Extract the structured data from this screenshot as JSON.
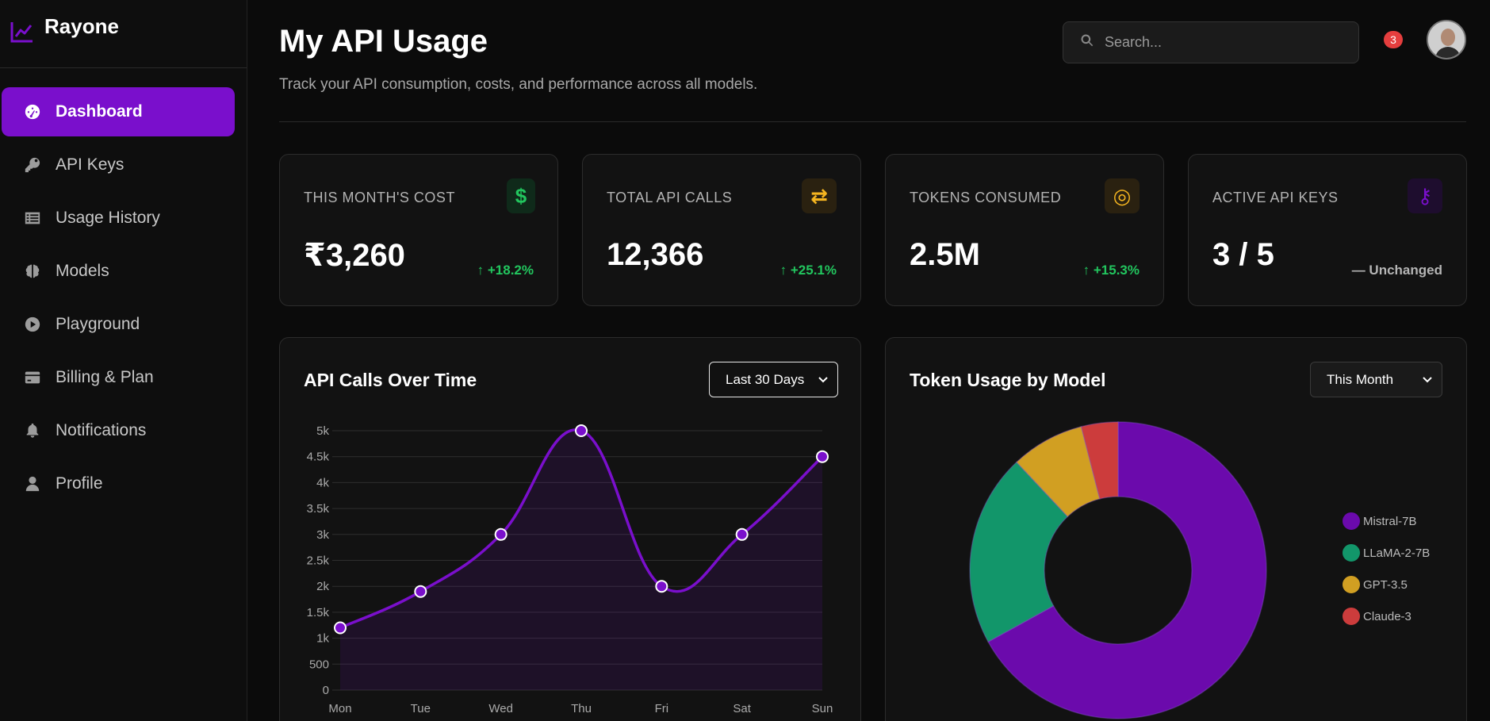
{
  "brand": {
    "name": "Rayone"
  },
  "sidebar": {
    "items": [
      {
        "label": "Dashboard",
        "icon": "gauge-icon",
        "active": true
      },
      {
        "label": "API Keys",
        "icon": "key-icon"
      },
      {
        "label": "Usage History",
        "icon": "list-icon"
      },
      {
        "label": "Models",
        "icon": "brain-icon"
      },
      {
        "label": "Playground",
        "icon": "play-icon"
      },
      {
        "label": "Billing & Plan",
        "icon": "credit-card-icon"
      },
      {
        "label": "Notifications",
        "icon": "bell-icon"
      },
      {
        "label": "Profile",
        "icon": "user-icon"
      }
    ]
  },
  "header": {
    "title": "My API Usage",
    "subtitle": "Track your API consumption, costs, and performance across all models.",
    "search_placeholder": "Search...",
    "notification_count": "3"
  },
  "stats": [
    {
      "label": "THIS MONTH'S COST",
      "value": "₹3,260",
      "change": "↑ +18.2%",
      "icon": "dollar-icon",
      "icon_glyph": "$",
      "accent": "#22c55e"
    },
    {
      "label": "TOTAL API CALLS",
      "value": "12,366",
      "change": "↑ +25.1%",
      "icon": "exchange-icon",
      "icon_glyph": "⇄",
      "accent": "#f5b520"
    },
    {
      "label": "TOKENS CONSUMED",
      "value": "2.5M",
      "change": "↑ +15.3%",
      "icon": "coins-icon",
      "icon_glyph": "◎",
      "accent": "#f5b520"
    },
    {
      "label": "ACTIVE API KEYS",
      "value": "3 / 5",
      "change": "— Unchanged",
      "icon": "key-icon",
      "icon_glyph": "⚷",
      "accent": "#7a0fcc"
    }
  ],
  "line_chart": {
    "title": "API Calls Over Time",
    "range_label": "Last 30 Days"
  },
  "donut_chart": {
    "title": "Token Usage by Model",
    "range_label": "This Month"
  },
  "colors": {
    "accent": "#7a0fcc",
    "success": "#22c55e",
    "warning": "#f5b520",
    "danger": "#e53e3e"
  },
  "chart_data": [
    {
      "type": "line",
      "title": "API Calls Over Time",
      "categories": [
        "Mon",
        "Tue",
        "Wed",
        "Thu",
        "Fri",
        "Sat",
        "Sun"
      ],
      "series": [
        {
          "values": [
            1200,
            1900,
            3000,
            5000,
            2000,
            3000,
            4500
          ]
        }
      ],
      "ylim": [
        0,
        5000
      ],
      "yticks": [
        "0",
        "500",
        "1k",
        "1.5k",
        "2k",
        "2.5k",
        "3k",
        "3.5k",
        "4k",
        "4.5k",
        "5k"
      ],
      "grid": true,
      "color": "#7a0fcc"
    },
    {
      "type": "pie",
      "title": "Token Usage by Model",
      "labels": [
        "Mistral-7B",
        "LLaMA-2-7B",
        "GPT-3.5",
        "Claude-3"
      ],
      "values": [
        67,
        21,
        8,
        4
      ],
      "colors": [
        "#6b0aac",
        "#12966a",
        "#d19f22",
        "#cc3c3c"
      ],
      "legend": "right"
    }
  ]
}
